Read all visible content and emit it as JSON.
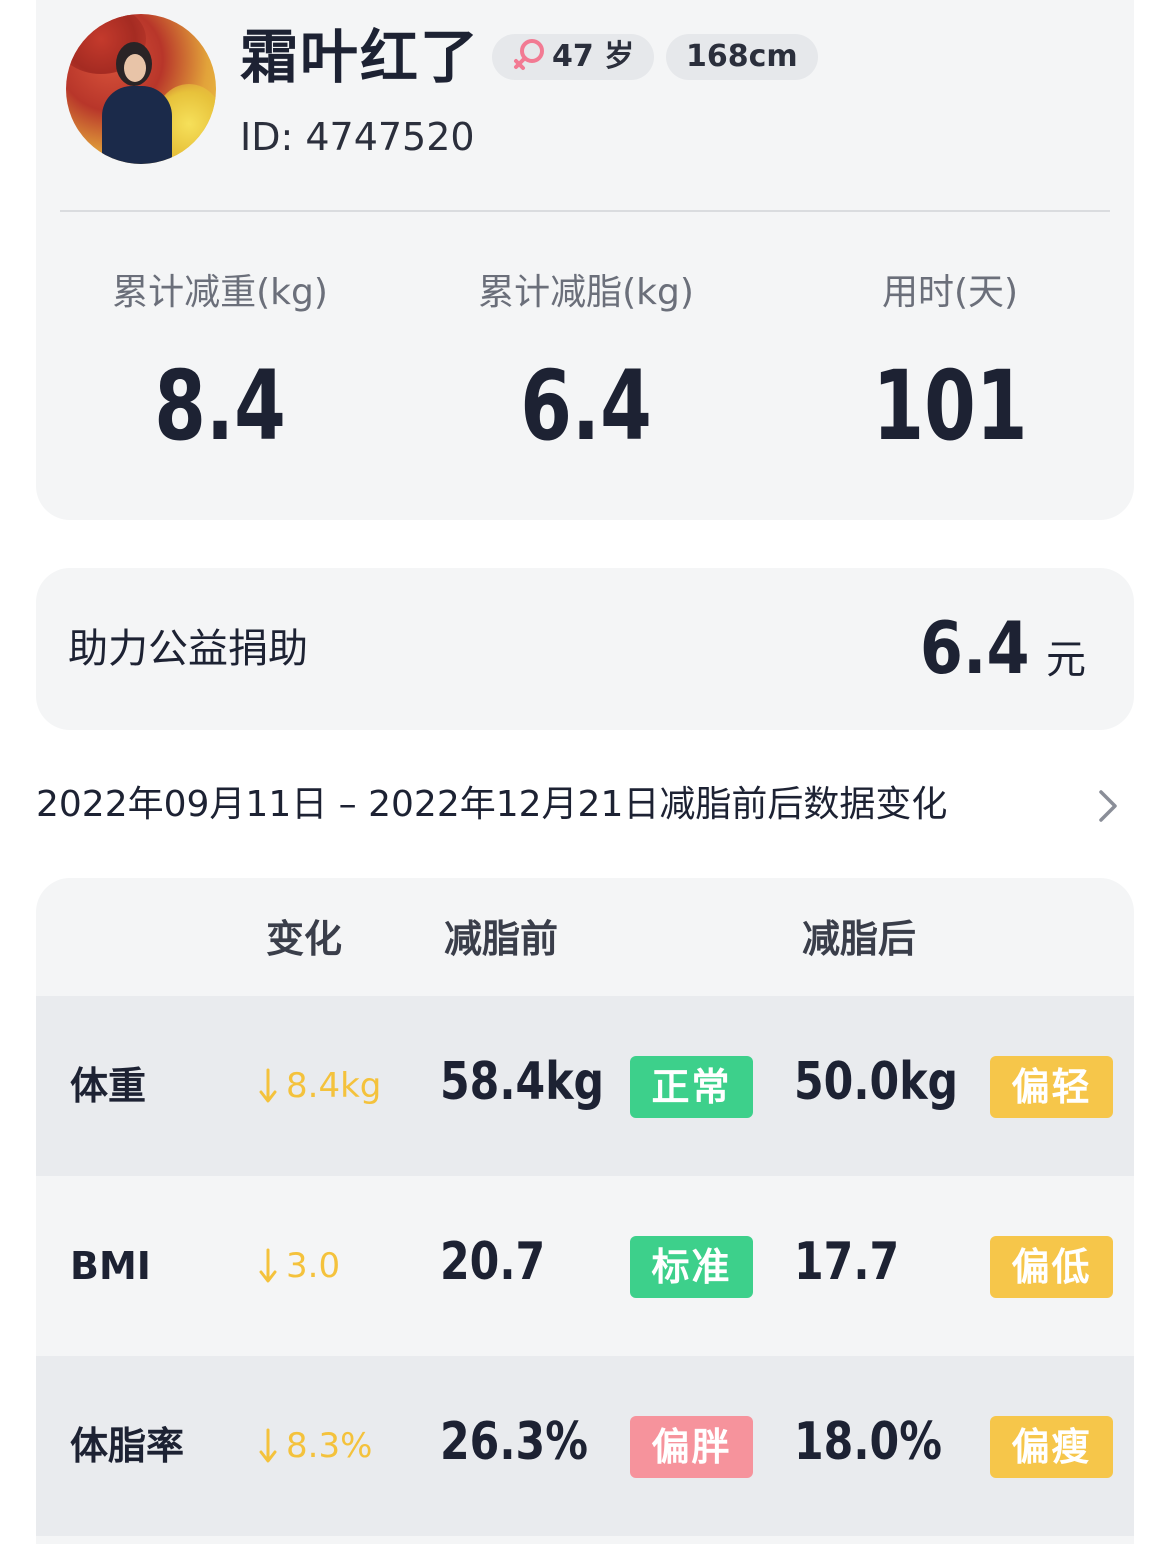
{
  "profile": {
    "name": "霜叶红了",
    "age": "47 岁",
    "height": "168cm",
    "id": "ID: 4747520",
    "gender_icon": "female-icon",
    "gender_color": "#f27a93"
  },
  "stats": [
    {
      "label": "累计减重(kg)",
      "value": "8.4"
    },
    {
      "label": "累计减脂(kg)",
      "value": "6.4"
    },
    {
      "label": "用时(天)",
      "value": "101"
    }
  ],
  "donation": {
    "label": "助力公益捐助",
    "value": "6.4",
    "unit": "元"
  },
  "range": {
    "text": "2022年09月11日 – 2022年12月21日减脂前后数据变化"
  },
  "table": {
    "headers": {
      "change": "变化",
      "before": "减脂前",
      "after": "减脂后"
    },
    "rows": [
      {
        "name": "体重",
        "change": "8.4kg",
        "before": "58.4kg",
        "before_status": "正常",
        "after": "50.0kg",
        "after_status": "偏轻"
      },
      {
        "name": "BMI",
        "change": "3.0",
        "before": "20.7",
        "before_status": "标准",
        "after": "17.7",
        "after_status": "偏低"
      },
      {
        "name": "体脂率",
        "change": "8.3%",
        "before": "26.3%",
        "before_status": "偏胖",
        "after": "18.0%",
        "after_status": "偏瘦"
      }
    ]
  },
  "colors": {
    "status_green": "#3dd08b",
    "status_yellow": "#f6c64a",
    "status_pink": "#f6939c",
    "change_yellow": "#f4c23c"
  }
}
